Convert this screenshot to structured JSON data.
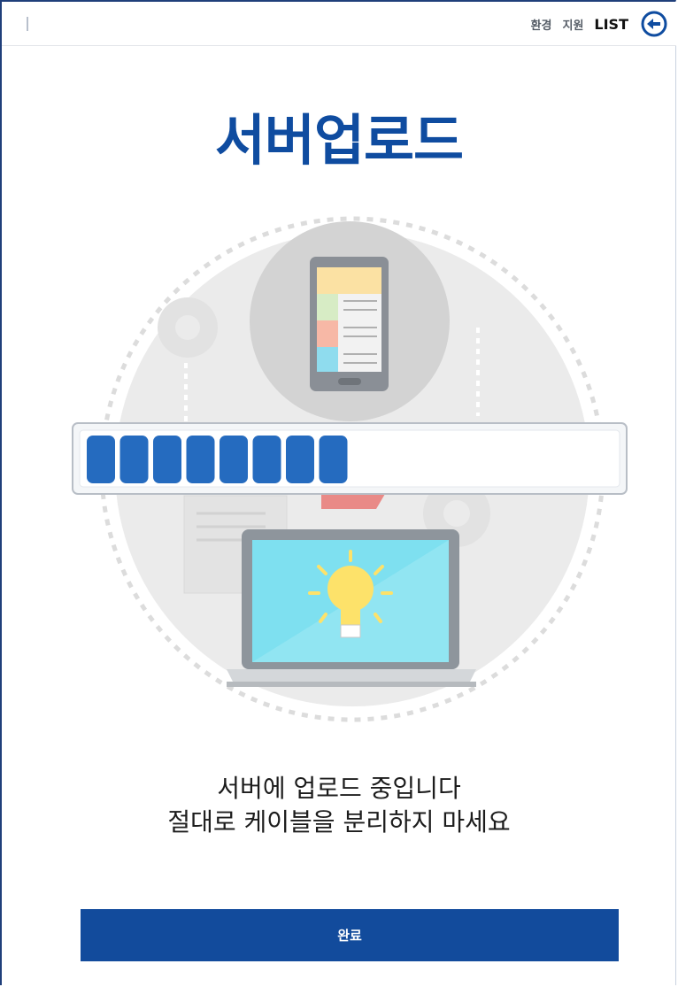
{
  "header": {
    "nav": {
      "env": "환경",
      "support": "지원",
      "list": "LIST"
    },
    "back_icon": "back-arrow-circle-icon"
  },
  "title": "서버업로드",
  "progress": {
    "filled_segments": 8,
    "total_segments": 16
  },
  "message": {
    "line1": "서버에 업로드 중입니다",
    "line2": "절대로 케이블을 분리하지 마세요"
  },
  "done_button": {
    "label": "완료"
  },
  "colors": {
    "accent": "#124b9c",
    "title": "#0f4ca0",
    "progress": "#256bbf"
  }
}
